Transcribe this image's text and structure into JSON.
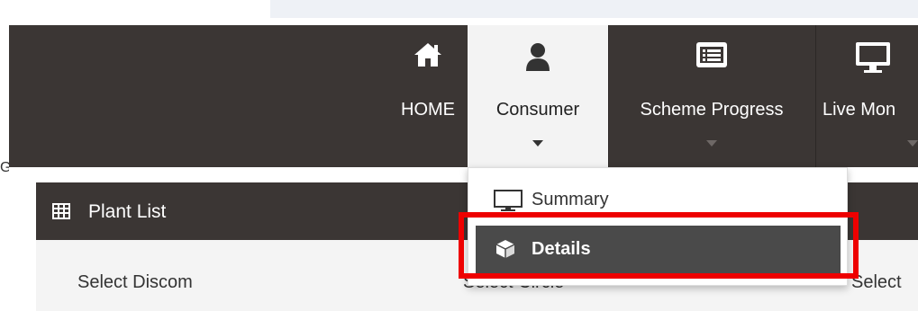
{
  "nav": {
    "home_label": "HOME",
    "consumer_label": "Consumer",
    "scheme_label": "Scheme Progress",
    "live_label": "Live Mon"
  },
  "dropdown": {
    "summary_label": "Summary",
    "details_label": "Details"
  },
  "left_fragment": "G",
  "panel": {
    "title": "Plant List"
  },
  "filters": {
    "discom_label": "Select Discom",
    "circle_label": "Select Circle",
    "third_label": "Select"
  },
  "colors": {
    "navbar_bg": "#3b3634",
    "active_tab_bg": "#f3f3f3",
    "highlight": "#ee0000",
    "details_bg": "#4a4a4a"
  }
}
